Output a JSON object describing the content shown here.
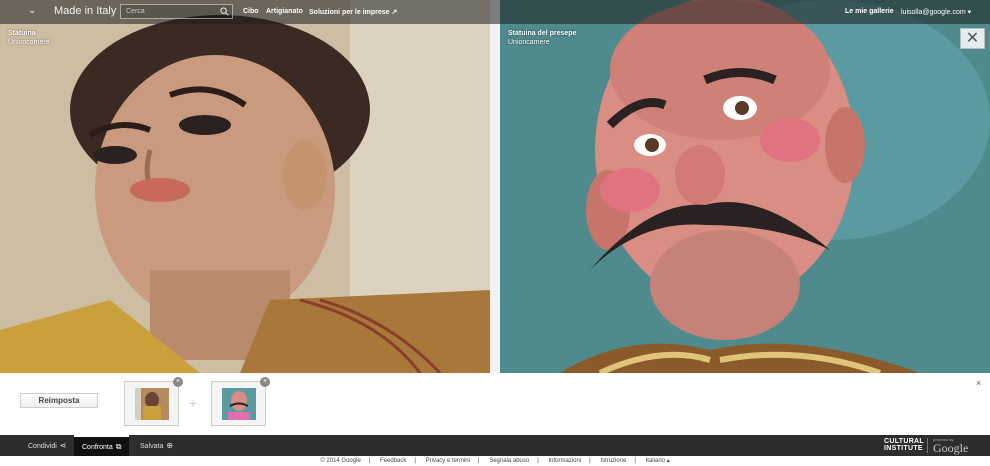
{
  "topbar": {
    "title": "Made in Italy",
    "search_placeholder": "Cerca",
    "nav": [
      "Cibo",
      "Artigianato",
      "Soluzioni per le imprese"
    ],
    "ext_icon": "↗",
    "my_galleries": "Le mie gallerie",
    "user": "luisolla@google.com ▾"
  },
  "panes": {
    "left": {
      "title": "Statuina",
      "owner": "Unioncamere"
    },
    "right": {
      "title": "Statuina del presepe",
      "owner": "Unioncamere"
    }
  },
  "close_symbol": "✕",
  "tray": {
    "reset_label": "Reimposta",
    "plus": "+",
    "slot_remove": "×",
    "close": "×"
  },
  "toolbar": {
    "share": "Condividi",
    "compare": "Confronta",
    "saved": "Salvata",
    "share_icon": "⋖",
    "compare_icon": "⧉",
    "saved_icon": "⊕"
  },
  "branding": {
    "line1": "CULTURAL",
    "line2": "INSTITUTE",
    "powered": "powered by",
    "google": "Google"
  },
  "footer": {
    "items": [
      "© 2014 Google",
      "Feedback",
      "Privacy e termini",
      "Segnala abuso",
      "Informazioni",
      "Istruzione",
      "Italiano ▴"
    ],
    "separator": "|"
  }
}
